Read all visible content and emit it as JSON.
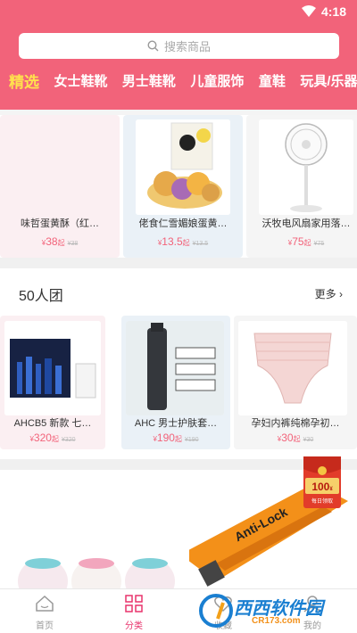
{
  "status": {
    "time": "4:18"
  },
  "search": {
    "placeholder": "搜索商品"
  },
  "tabs": [
    "精选",
    "女士鞋靴",
    "男士鞋靴",
    "儿童服饰",
    "童鞋",
    "玩具/乐器"
  ],
  "featured": [
    {
      "name": "味哲蛋黄酥（红…",
      "yen": "¥",
      "price": "38",
      "unit": "起",
      "old": "¥38"
    },
    {
      "name": "佬食仁雪媚娘蛋黄…",
      "yen": "¥",
      "price": "13.5",
      "unit": "起",
      "old": "¥13.5"
    },
    {
      "name": "沃牧电风扇家用落…",
      "yen": "¥",
      "price": "75",
      "unit": "起",
      "old": "¥75"
    }
  ],
  "group": {
    "title": "50人团",
    "more": "更多",
    "items": [
      {
        "name": "AHCB5 新款 七…",
        "yen": "¥",
        "price": "320",
        "unit": "起",
        "old": "¥320"
      },
      {
        "name": "AHC 男士护肤套…",
        "yen": "¥",
        "price": "190",
        "unit": "起",
        "old": "¥190"
      },
      {
        "name": "孕妇内裤纯棉孕初…",
        "yen": "¥",
        "price": "30",
        "unit": "起",
        "old": "¥30"
      }
    ]
  },
  "coupon": {
    "amount": "100",
    "sub": "¥",
    "label": "每日领取"
  },
  "banner": {
    "product_text": "Anti-Lock"
  },
  "nav": [
    {
      "label": "首页",
      "icon": "home-icon"
    },
    {
      "label": "分类",
      "icon": "category-icon"
    },
    {
      "label": "收藏",
      "icon": "favorite-icon"
    },
    {
      "label": "我的",
      "icon": "profile-icon"
    }
  ],
  "watermark": {
    "text": "西西软件园",
    "url": "CR173.com"
  },
  "colors": {
    "primary": "#f2637a",
    "tab_active": "#ffe14d",
    "price": "#f2637a",
    "nav_active": "#e8336c"
  }
}
